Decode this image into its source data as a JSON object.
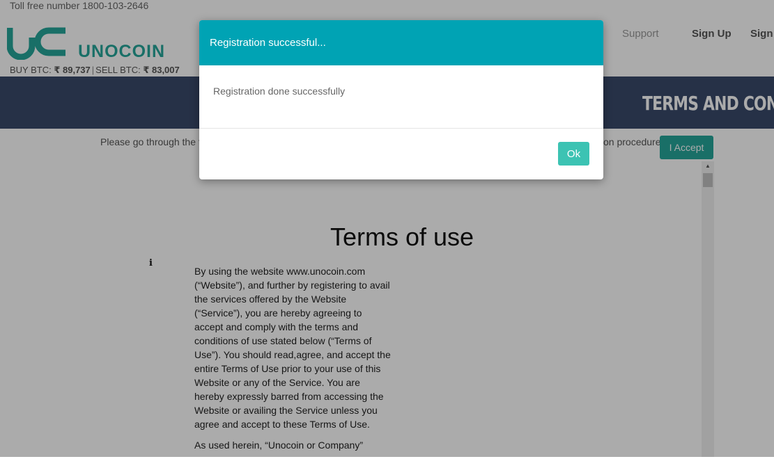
{
  "header": {
    "toll_free": "Toll free number 1800-103-2646",
    "brand": "UNOCOIN",
    "buy_label": "BUY BTC:",
    "buy_value": "₹ 89,737",
    "separator": "|",
    "sell_label": "SELL BTC:",
    "sell_value": "₹ 83,007"
  },
  "nav": {
    "support": "Support",
    "signup": "Sign Up",
    "signin": "Sign"
  },
  "banner": {
    "title": "TERMS AND CONDITIO"
  },
  "notice": {
    "text_start": "Please go through the te",
    "text_end": "on procedure",
    "accept_button": "I Accept"
  },
  "terms": {
    "heading": "Terms of use",
    "info_icon": "i",
    "paragraph1": "By using the website www.unocoin.com (“Website”), and further by registering to avail the services offered by the Website (“Service”), you are hereby agreeing to accept and comply with the terms and conditions of use stated below (“Terms of Use”). You should read,agree, and accept the entire Terms of Use prior to your use of this Website or any of the Service. You are hereby expressly barred from accessing the Website or availing the Service unless you agree and accept to these Terms of Use.",
    "paragraph2": "As used herein, “Unocoin or Company”"
  },
  "modal": {
    "title": "Registration successful...",
    "message": "Registration done successfully",
    "ok_button": "Ok"
  },
  "colors": {
    "brand_teal": "#26a69a",
    "modal_header": "#00a3b4",
    "ok_button": "#3cc3b3",
    "banner_bg": "#3a4a6b"
  },
  "icons": {
    "logo": "uc-logo-icon",
    "info": "info-icon",
    "scroll_up": "scroll-up-arrow-icon"
  }
}
